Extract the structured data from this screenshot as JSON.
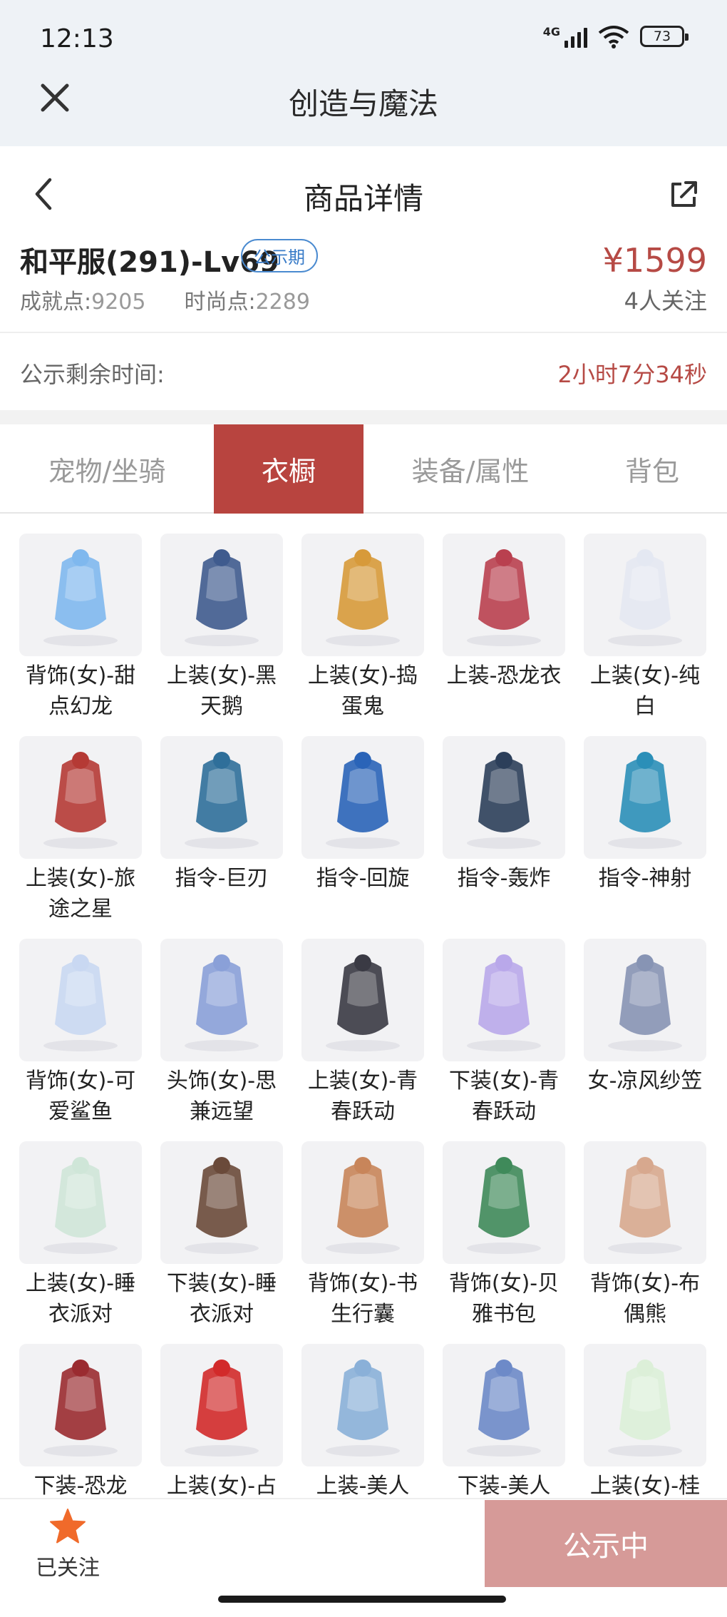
{
  "status_bar": {
    "time": "12:13",
    "network": "4G",
    "battery": "73"
  },
  "app": {
    "title": "创造与魔法",
    "close_icon": "close-icon"
  },
  "header": {
    "title": "商品详情",
    "back_icon": "chevron-left-icon",
    "share_icon": "share-icon"
  },
  "product": {
    "name": "和平服(291)-Lv69",
    "badge": "公示期",
    "price": "¥1599",
    "achievement_label": "成就点:",
    "achievement_value": "9205",
    "fashion_label": "时尚点:",
    "fashion_value": "2289",
    "followers": "4人关注"
  },
  "remaining": {
    "label": "公示剩余时间:",
    "value": "2小时7分34秒"
  },
  "tabs": [
    {
      "label": "宠物/坐骑",
      "active": false
    },
    {
      "label": "衣橱",
      "active": true
    },
    {
      "label": "装备/属性",
      "active": false
    },
    {
      "label": "背包",
      "active": false
    }
  ],
  "items": [
    {
      "name": "背饰(女)-甜点幻龙",
      "icon": "dragon-pet-icon",
      "color": "#7fb8ee"
    },
    {
      "name": "上装(女)-黑天鹅",
      "icon": "dress-icon",
      "color": "#3f5b8e"
    },
    {
      "name": "上装(女)-捣蛋鬼",
      "icon": "dress-icon",
      "color": "#d79a3a"
    },
    {
      "name": "上装-恐龙衣",
      "icon": "costume-icon",
      "color": "#b9404f"
    },
    {
      "name": "上装(女)-纯白",
      "icon": "dress-icon",
      "color": "#e4e8f2"
    },
    {
      "name": "上装(女)-旅途之星",
      "icon": "outfit-icon",
      "color": "#b53a35"
    },
    {
      "name": "指令-巨刃",
      "icon": "blade-icon",
      "color": "#2f6f9a"
    },
    {
      "name": "指令-回旋",
      "icon": "scythe-icon",
      "color": "#2a64b8"
    },
    {
      "name": "指令-轰炸",
      "icon": "cannon-icon",
      "color": "#2c3f5a"
    },
    {
      "name": "指令-神射",
      "icon": "bow-icon",
      "color": "#2b8fb8"
    },
    {
      "name": "背饰(女)-可爱鲨鱼",
      "icon": "shark-icon",
      "color": "#c9d8f2"
    },
    {
      "name": "头饰(女)-思兼远望",
      "icon": "helmet-icon",
      "color": "#8aa0d8"
    },
    {
      "name": "上装(女)-青春跃动",
      "icon": "jacket-icon",
      "color": "#3a3a44"
    },
    {
      "name": "下装(女)-青春跃动",
      "icon": "skirt-icon",
      "color": "#b9a8ea"
    },
    {
      "name": "女-凉风纱笠",
      "icon": "veil-hat-icon",
      "color": "#8794b4"
    },
    {
      "name": "上装(女)-睡衣派对",
      "icon": "pajama-icon",
      "color": "#cfe6d8"
    },
    {
      "name": "下装(女)-睡衣派对",
      "icon": "slippers-icon",
      "color": "#6a4a3a"
    },
    {
      "name": "背饰(女)-书生行囊",
      "icon": "book-box-icon",
      "color": "#c8855a"
    },
    {
      "name": "背饰(女)-贝雅书包",
      "icon": "backpack-icon",
      "color": "#3f8a5a"
    },
    {
      "name": "背饰(女)-布偶熊",
      "icon": "teddy-bear-icon",
      "color": "#d7a88e"
    },
    {
      "name": "下装-恐龙",
      "icon": "dino-feet-icon",
      "color": "#9a2b30"
    },
    {
      "name": "上装(女)-占",
      "icon": "dress-icon",
      "color": "#d22a2a"
    },
    {
      "name": "上装-美人",
      "icon": "armor-icon",
      "color": "#8ab0d8"
    },
    {
      "name": "下装-美人",
      "icon": "robe-icon",
      "color": "#6d8ac8"
    },
    {
      "name": "上装(女)-桂",
      "icon": "outfit-icon",
      "color": "#dcefd8"
    }
  ],
  "bottom": {
    "follow_label": "已关注",
    "follow_icon": "star-icon",
    "status_label": "公示中"
  }
}
